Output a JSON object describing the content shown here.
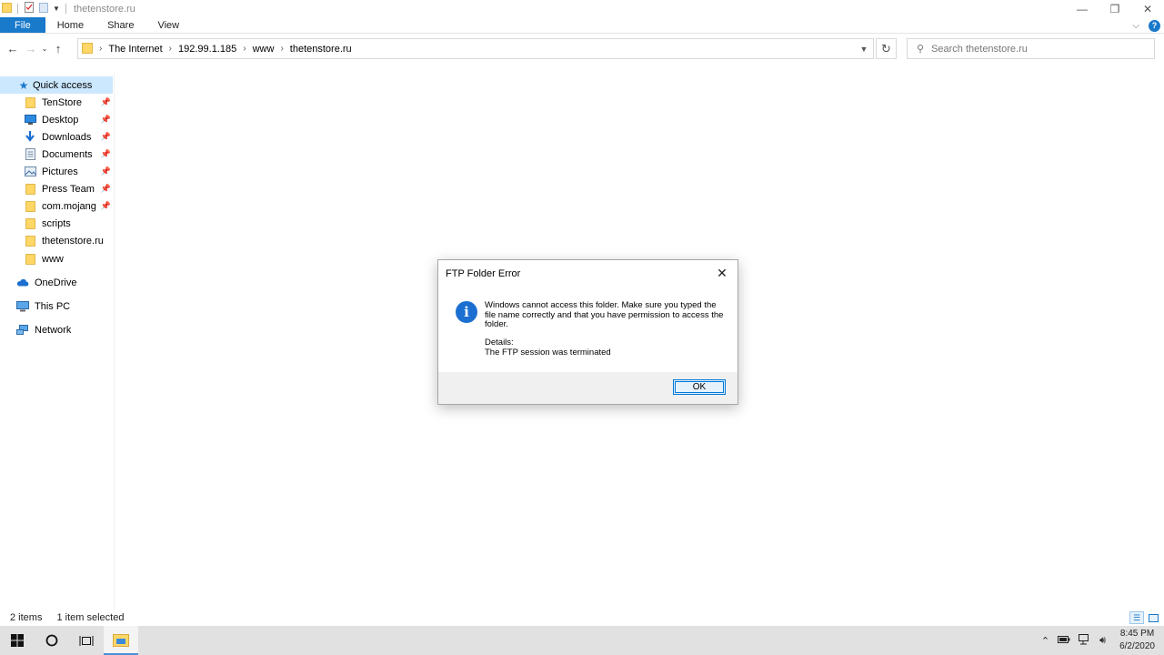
{
  "window": {
    "title": "thetenstore.ru",
    "controls": {
      "minimize": "—",
      "restore": "❐",
      "close": "✕"
    }
  },
  "ribbon": {
    "tabs": [
      "File",
      "Home",
      "Share",
      "View"
    ],
    "help": "?"
  },
  "address": {
    "crumbs": [
      "The Internet",
      "192.99.1.185",
      "www",
      "thetenstore.ru"
    ]
  },
  "search": {
    "placeholder": "Search thetenstore.ru"
  },
  "sidebar": {
    "quick_access": "Quick access",
    "items": [
      {
        "label": "TenStore",
        "icon": "folder-icon",
        "pinned": true
      },
      {
        "label": "Desktop",
        "icon": "desktop-icon",
        "pinned": true
      },
      {
        "label": "Downloads",
        "icon": "download-icon",
        "pinned": true
      },
      {
        "label": "Documents",
        "icon": "documents-icon",
        "pinned": true
      },
      {
        "label": "Pictures",
        "icon": "pictures-icon",
        "pinned": true
      },
      {
        "label": "Press Team",
        "icon": "folder-icon",
        "pinned": true
      },
      {
        "label": "com.mojang",
        "icon": "folder-icon",
        "pinned": true
      },
      {
        "label": "scripts",
        "icon": "folder-icon",
        "pinned": false
      },
      {
        "label": "thetenstore.ru",
        "icon": "folder-icon",
        "pinned": false
      },
      {
        "label": "www",
        "icon": "folder-icon",
        "pinned": false
      }
    ],
    "onedrive": "OneDrive",
    "thispc": "This PC",
    "network": "Network"
  },
  "status": {
    "items": "2 items",
    "selected": "1 item selected"
  },
  "dialog": {
    "title": "FTP Folder Error",
    "message": "Windows cannot access this folder. Make sure you typed the file name correctly and that you have permission to access the folder.",
    "details_label": "Details:",
    "details_text": "The FTP session was terminated",
    "ok_label": "OK"
  },
  "taskbar": {
    "time": "8:45 PM",
    "date": "6/2/2020"
  },
  "colors": {
    "accent": "#1979ca",
    "selection": "#cce8ff",
    "folder": "#ffd766",
    "taskbar": "#e1e1e1"
  }
}
